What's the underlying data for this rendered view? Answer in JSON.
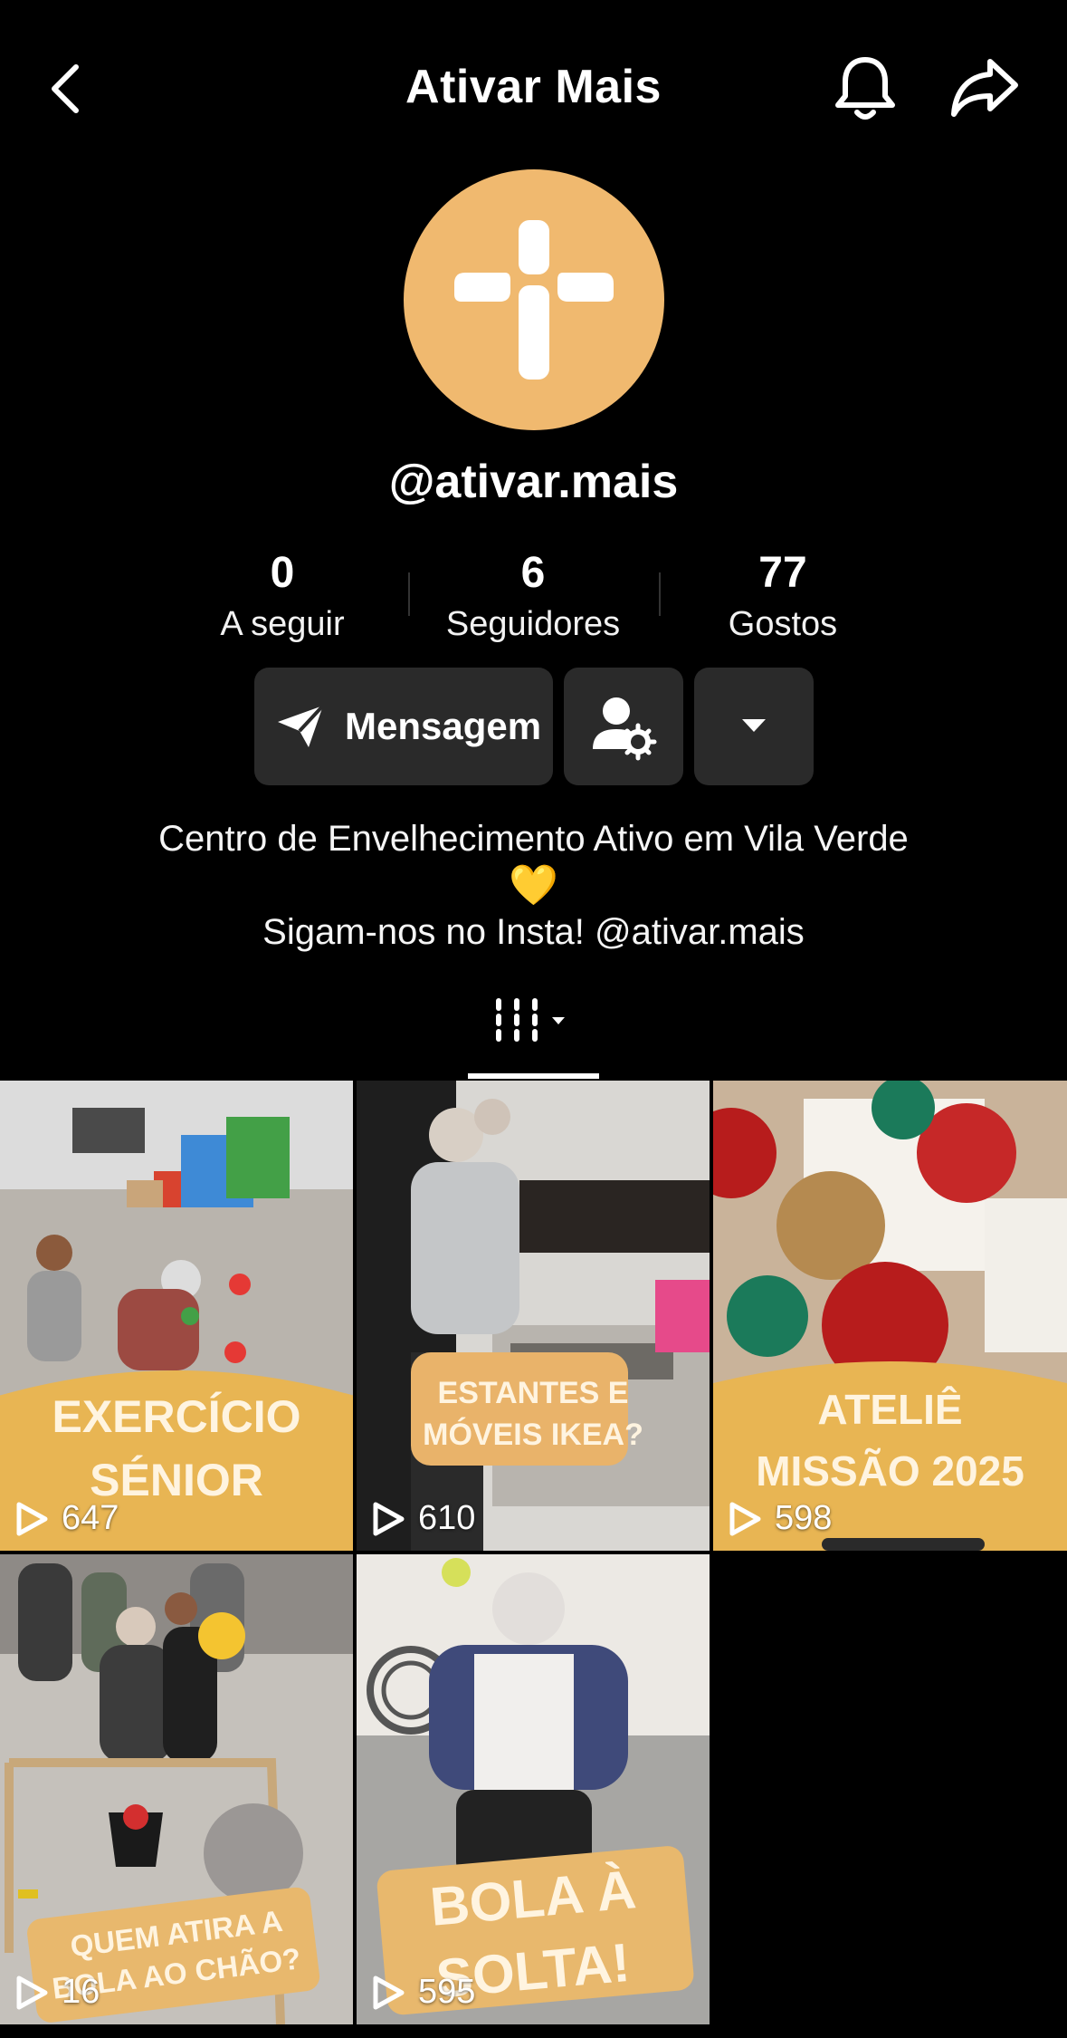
{
  "header": {
    "title": "Ativar Mais"
  },
  "profile": {
    "handle": "@ativar.mais",
    "avatar_color": "#f0b96f"
  },
  "stats": [
    {
      "value": "0",
      "label": "A seguir"
    },
    {
      "value": "6",
      "label": "Seguidores"
    },
    {
      "value": "77",
      "label": "Gostos"
    }
  ],
  "actions": {
    "message_label": "Mensagem"
  },
  "bio": {
    "line1": "Centro de Envelhecimento Ativo em Vila Verde",
    "line2": "💛",
    "line3": "Sigam-nos no Insta! @ativar.mais"
  },
  "videos": [
    {
      "caption_line1": "EXERCÍCIO",
      "caption_line2": "SÉNIOR",
      "views": "647"
    },
    {
      "caption_line1": "ESTANTES E",
      "caption_line2": "MÓVEIS IKEA?",
      "views": "610"
    },
    {
      "caption_line1": "ATELIÊ",
      "caption_line2": "MISSÃO 2025",
      "views": "598"
    },
    {
      "caption_line1": "QUEM ATIRA A",
      "caption_line2": "BOLA AO CHÃO?",
      "views": "16"
    },
    {
      "caption_line1": "BOLA À",
      "caption_line2": "SOLTA!",
      "views": "595"
    }
  ],
  "icons": {
    "back": "chevron-left-icon",
    "bell": "bell-icon",
    "share": "share-arrow-icon",
    "send": "send-icon",
    "person_settings": "person-gear-icon",
    "dropdown": "caret-down-icon",
    "grid": "grid-icon",
    "play": "play-icon"
  }
}
